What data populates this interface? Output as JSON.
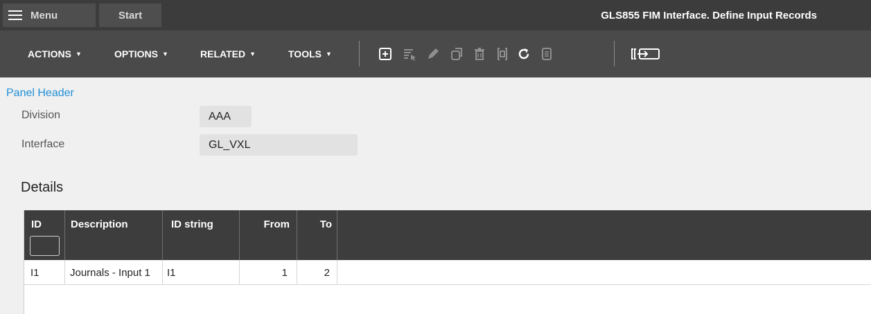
{
  "titlebar": {
    "menu_label": "Menu",
    "start_label": "Start",
    "title": "GLS855 FIM Interface. Define Input Records"
  },
  "toolbar": {
    "menus": [
      {
        "label": "ACTIONS"
      },
      {
        "label": "OPTIONS"
      },
      {
        "label": "RELATED"
      },
      {
        "label": "TOOLS"
      }
    ],
    "icons": [
      "add-icon",
      "select-rows-icon",
      "edit-icon",
      "copy-icon",
      "delete-icon",
      "display-icon",
      "refresh-icon",
      "notes-icon",
      "export-icon"
    ]
  },
  "panel": {
    "title": "Panel Header",
    "division_label": "Division",
    "division_value": "AAA",
    "interface_label": "Interface",
    "interface_value": "GL_VXL"
  },
  "details": {
    "title": "Details",
    "columns": [
      "ID",
      "Description",
      "ID string",
      "From",
      "To"
    ],
    "rows": [
      {
        "id": "I1",
        "description": "Journals - Input 1",
        "id_string": "I1",
        "from": "1",
        "to": "2"
      }
    ]
  }
}
